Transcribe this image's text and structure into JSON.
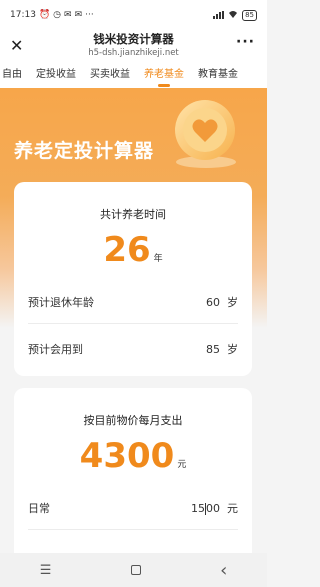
{
  "status": {
    "time": "17:13",
    "icons_left": [
      "alarm-icon",
      "clock-icon",
      "notification-icon",
      "notification-icon",
      "more-dots"
    ],
    "more": "···",
    "battery": "85"
  },
  "titlebar": {
    "title": "钱米投资计算器",
    "subtitle": "h5-dsh.jianzhikeji.net",
    "close": "✕",
    "more": "···"
  },
  "tabs": [
    {
      "label": "自由"
    },
    {
      "label": "定投收益"
    },
    {
      "label": "买卖收益"
    },
    {
      "label": "养老基金",
      "active": true
    },
    {
      "label": "教育基金"
    }
  ],
  "hero": {
    "title": "养老定投计算器"
  },
  "card1": {
    "title": "共计养老时间",
    "value": "26",
    "unit": "年",
    "rows": [
      {
        "label": "预计退休年龄",
        "value": "60",
        "unit": "岁"
      },
      {
        "label": "预计会用到",
        "value": "85",
        "unit": "岁"
      }
    ]
  },
  "card2": {
    "title": "按目前物价每月支出",
    "value": "4300",
    "unit": "元",
    "rows": [
      {
        "label": "日常",
        "value_a": "15",
        "value_b": "00",
        "unit": "元"
      }
    ]
  },
  "navbar": {
    "menu": "☰",
    "back": "‹"
  },
  "colors": {
    "accent": "#f08a1c",
    "hero": "#f7a64a"
  }
}
